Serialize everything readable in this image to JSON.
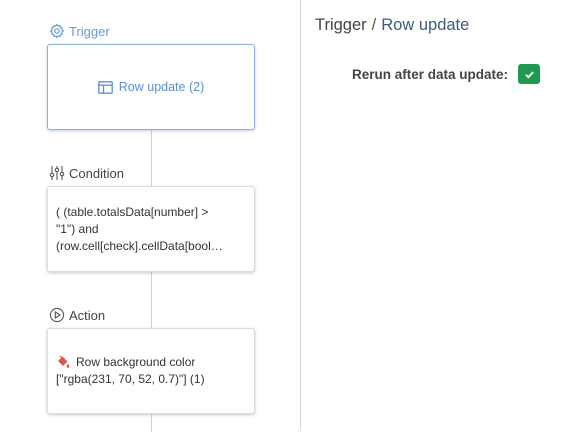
{
  "flow": {
    "trigger": {
      "label": "Trigger",
      "card_text": "Row update (2)"
    },
    "condition": {
      "label": "Condition",
      "lines": [
        "( (table.totalsData[number] >",
        "\"1\") and",
        "(row.cell[check].cellData[bool…"
      ]
    },
    "action": {
      "label": "Action",
      "lines": [
        "Row background color",
        "[\"rgba(231, 70, 52, 0.7)\"] (1)"
      ]
    }
  },
  "detail": {
    "breadcrumb_parent": "Trigger",
    "breadcrumb_separator": "/",
    "breadcrumb_current": "Row update",
    "rerun_label": "Rerun after data update:",
    "rerun_checked": true
  },
  "colors": {
    "trigger_accent": "#6a9ad6",
    "checkbox_green": "#1f9a4e",
    "paint_bucket": "#e0554a"
  }
}
